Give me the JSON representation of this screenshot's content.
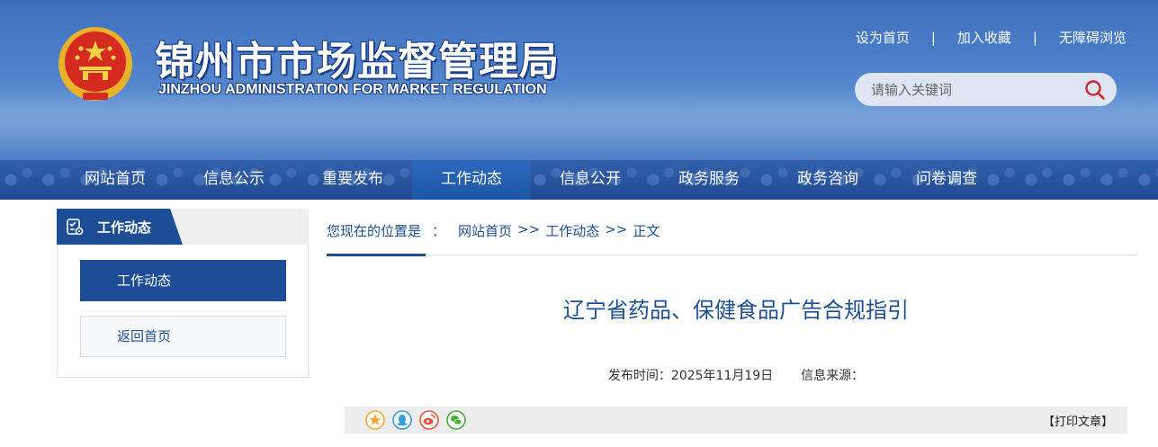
{
  "header": {
    "site_title_cn": "锦州市市场监督管理局",
    "site_title_en": "JINZHOU ADMINISTRATION FOR MARKET REGULATION",
    "top_links": [
      "设为首页",
      "加入收藏",
      "无障碍浏览"
    ],
    "separator": "|",
    "search": {
      "placeholder": "请输入关键词"
    }
  },
  "nav": {
    "items": [
      "网站首页",
      "信息公示",
      "重要发布",
      "工作动态",
      "信息公开",
      "政务服务",
      "政务咨询",
      "问卷调查"
    ],
    "active_index": 3
  },
  "sidebar": {
    "heading": "工作动态",
    "links": [
      {
        "label": "工作动态",
        "active": true
      },
      {
        "label": "返回首页",
        "active": false
      }
    ]
  },
  "breadcrumb": {
    "prefix": "您现在的位置是",
    "colon": "：",
    "items": [
      "网站首页",
      "工作动态",
      "正文"
    ],
    "separator": ">>"
  },
  "article": {
    "title": "辽宁省药品、保健食品广告合规指引",
    "publish_label": "发布时间：2025年11月19日",
    "source_label": "信息来源："
  },
  "share": {
    "icons": [
      "favorite-icon",
      "qq-icon",
      "weibo-icon",
      "wechat-icon"
    ],
    "print_label": "【打印文章】"
  },
  "colors": {
    "brand_blue": "#1d4e95",
    "nav_active": "#1d56a5",
    "text_blue": "#1f4f93"
  }
}
